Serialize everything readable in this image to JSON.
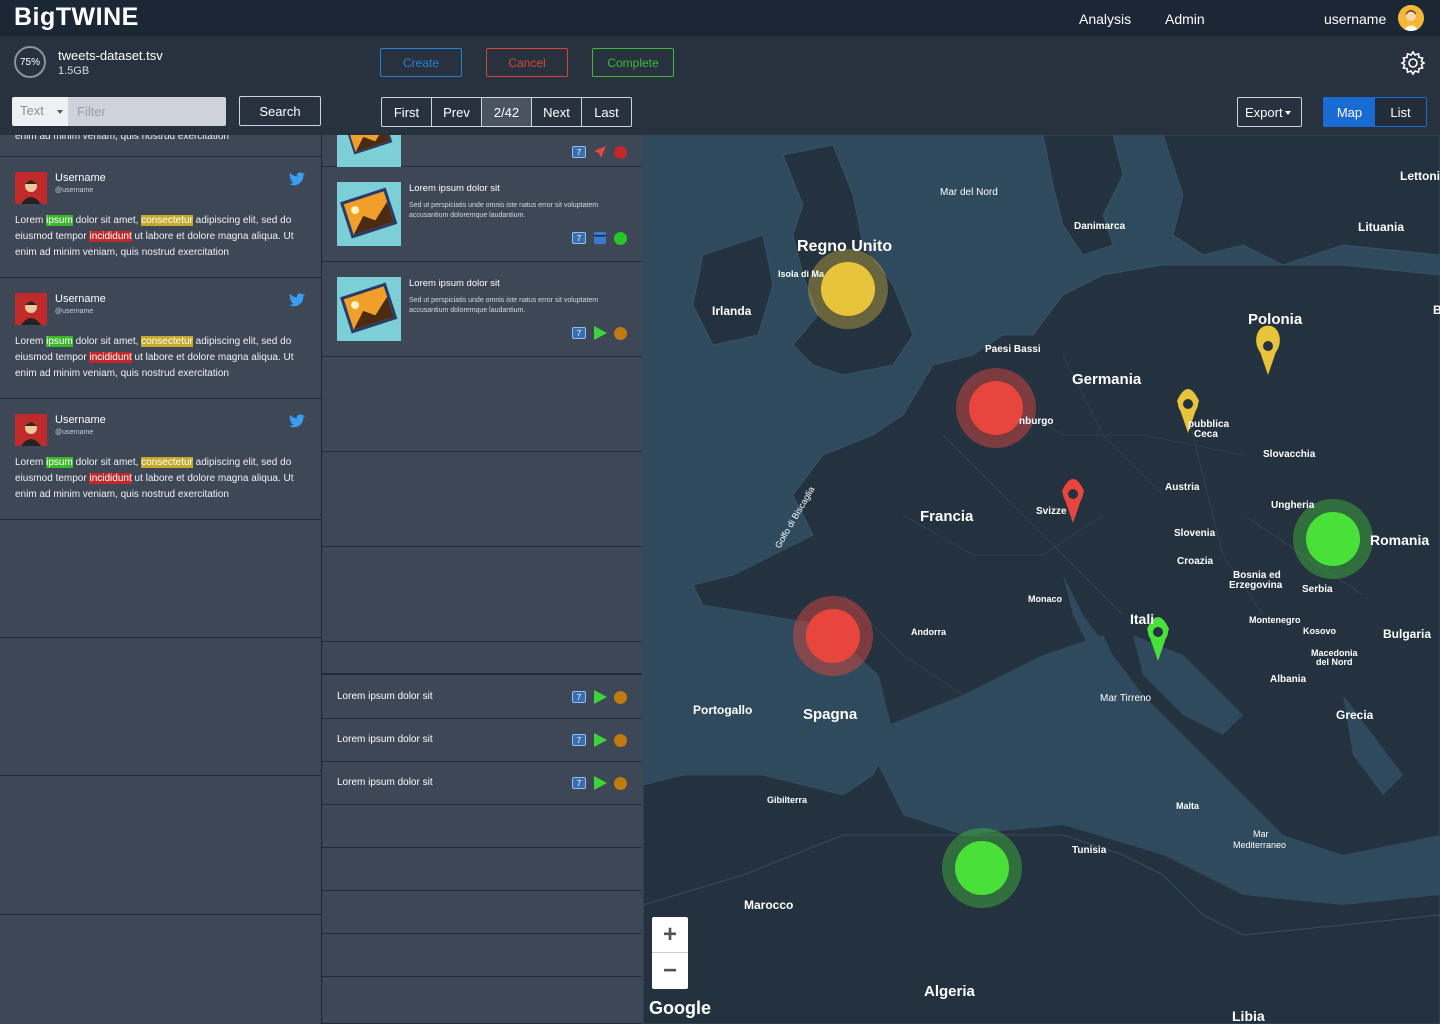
{
  "app": {
    "name": "BigTWINE"
  },
  "nav": {
    "analysis": "Analysis",
    "admin": "Admin",
    "username": "username"
  },
  "job": {
    "progress": "75%",
    "progress_value": 0.75,
    "filename": "tweets-dataset.tsv",
    "filesize": "1.5GB"
  },
  "actions": {
    "create": "Create",
    "cancel": "Cancel",
    "complete": "Complete"
  },
  "search": {
    "type_value": "Text",
    "filter_placeholder": "Filter",
    "button": "Search"
  },
  "pager": {
    "first": "First",
    "prev": "Prev",
    "current": "2/42",
    "next": "Next",
    "last": "Last"
  },
  "export": {
    "label": "Export"
  },
  "view": {
    "map": "Map",
    "list": "List",
    "active": "Map"
  },
  "tweets": {
    "partial_text": "enim ad minim veniam, quis nostrud exercitation",
    "items": [
      {
        "name": "Username",
        "handle": "@username",
        "t1": "Lorem ",
        "h1": "ipsum",
        "t2": " dolor sit amet, ",
        "h2": "consectetur",
        "t3": " adipiscing elit, sed do eiusmod tempor ",
        "h3": "incididunt",
        "t4": " ut labore et dolore magna aliqua. Ut enim ad minim veniam, quis nostrud exercitation"
      },
      {
        "name": "Username",
        "handle": "@username",
        "t1": "Lorem ",
        "h1": "ipsum",
        "t2": " dolor sit amet, ",
        "h2": "consectetur",
        "t3": " adipiscing elit, sed do eiusmod tempor ",
        "h3": "incididunt",
        "t4": " ut labore et dolore magna aliqua. Ut enim ad minim veniam, quis nostrud exercitation"
      },
      {
        "name": "Username",
        "handle": "@username",
        "t1": "Lorem ",
        "h1": "ipsum",
        "t2": " dolor sit amet, ",
        "h2": "consectetur",
        "t3": " adipiscing elit, sed do eiusmod tempor ",
        "h3": "incididunt",
        "t4": " ut labore et dolore magna aliqua. Ut enim ad minim veniam, quis nostrud exercitation"
      }
    ]
  },
  "media": {
    "items": [
      {
        "title": "Lorem ipsum dolor sit",
        "desc": "Sed ut perspiciatis unde omnis iste natus error sit voluptatem accusantium doloremque laudantium.",
        "badge": "7",
        "status_color": "#27c527"
      },
      {
        "title": "Lorem ipsum dolor sit",
        "desc": "Sed ut perspiciatis unde omnis iste natus error sit voluptatem accusantium doloremque laudantium.",
        "badge": "7",
        "status_color": "#c07a10"
      }
    ],
    "partial_badge": "7",
    "list": [
      {
        "title": "Lorem ipsum dolor sit",
        "badge": "7"
      },
      {
        "title": "Lorem ipsum dolor sit",
        "badge": "7"
      },
      {
        "title": "Lorem ipsum dolor sit",
        "badge": "7"
      }
    ]
  },
  "map": {
    "labels": {
      "mar_del_nord": "Mar del Nord",
      "lettonia": "Lettoni",
      "danimarca": "Danimarca",
      "lituania": "Lituania",
      "regno_unito": "Regno Unito",
      "isola_di_man": "Isola di Ma",
      "irlanda": "Irlanda",
      "polonia": "Polonia",
      "paesi_bassi": "Paesi Bassi",
      "germania": "Germania",
      "lussemburgo": "nburgo",
      "repubblica": "pubblica",
      "ceca": "Ceca",
      "slovacchia": "Slovacchia",
      "austria": "Austria",
      "francia": "Francia",
      "svizzera": "Svizze",
      "ungheria": "Ungheria",
      "romania": "Romania",
      "slovenia": "Slovenia",
      "croazia": "Croazia",
      "bosnia": "Bosnia ed",
      "erzegovina": "Erzegovina",
      "serbia": "Serbia",
      "golfo": "Golfo di Biscaglia",
      "monaco": "Monaco",
      "andorra": "Andorra",
      "italia": "Itali",
      "montenegro": "Montenegro",
      "kosovo": "Kosovo",
      "bulgaria": "Bulgaria",
      "macedonia": "Macedonia",
      "del_nord": "del Nord",
      "albania": "Albania",
      "portogallo": "Portogallo",
      "spagna": "Spagna",
      "mar_tirreno": "Mar Tirreno",
      "grecia": "Grecia",
      "gibilterra": "Gibilterra",
      "malta": "Malta",
      "mar_med1": "Mar",
      "mar_med2": "Mediterraneo",
      "tunisia": "Tunisia",
      "marocco": "Marocco",
      "algeria": "Algeria",
      "libia": "Libia",
      "b": "B"
    },
    "colors": {
      "yellow": "#e8c43a",
      "red": "#e8463c",
      "green": "#4ae03a",
      "water": "#2e4a5c",
      "land": "#243240"
    },
    "zoom_in": "+",
    "zoom_out": "−",
    "attribution": "Google"
  }
}
